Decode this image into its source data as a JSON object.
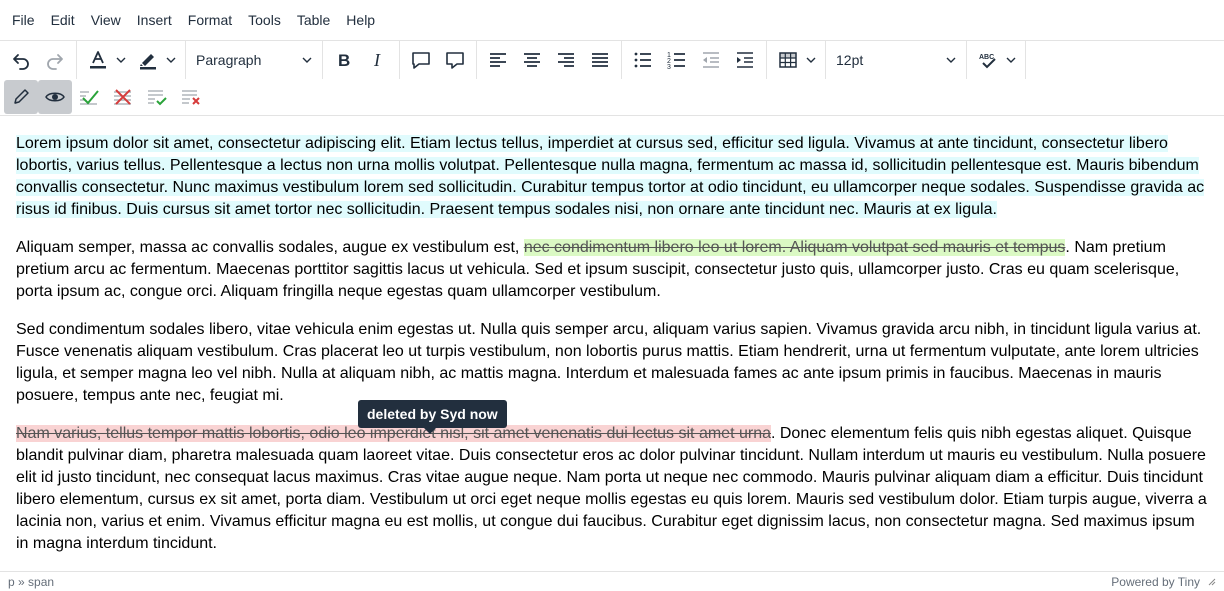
{
  "menubar": {
    "items": [
      {
        "label": "File"
      },
      {
        "label": "Edit"
      },
      {
        "label": "View"
      },
      {
        "label": "Insert"
      },
      {
        "label": "Format"
      },
      {
        "label": "Tools"
      },
      {
        "label": "Table"
      },
      {
        "label": "Help"
      }
    ]
  },
  "toolbar": {
    "block_format": "Paragraph",
    "font_size": "12pt",
    "icons": {
      "undo": "undo-icon",
      "redo": "redo-icon",
      "text_color": "text-color-icon",
      "highlight": "highlight-icon",
      "bold": "bold-icon",
      "italic": "italic-icon",
      "comment_add": "comment-add-icon",
      "comment_show": "comment-show-icon",
      "align_left": "align-left-icon",
      "align_center": "align-center-icon",
      "align_right": "align-right-icon",
      "align_justify": "align-justify-icon",
      "bullet_list": "bullet-list-icon",
      "numbered_list": "numbered-list-icon",
      "outdent": "outdent-icon",
      "indent": "indent-icon",
      "table": "table-icon",
      "spellcheck": "spellcheck-icon"
    },
    "colors": {
      "text_color_bar": "#222f3e",
      "highlight_bar": "#222f3e"
    }
  },
  "revisions_toolbar": {
    "icons": {
      "track_changes": "pencil-icon",
      "show_changes": "eye-icon",
      "accept": "accept-change-icon",
      "reject": "reject-change-icon",
      "accept_all": "accept-all-icon",
      "reject_all": "reject-all-icon"
    },
    "colors": {
      "accept": "#2aa33a",
      "reject": "#d63b3b"
    }
  },
  "document": {
    "p1": "Lorem ipsum dolor sit amet, consectetur adipiscing elit. Etiam lectus tellus, imperdiet at cursus sed, efficitur sed ligula. Vivamus at ante tincidunt, consectetur libero lobortis, varius tellus. Pellentesque a lectus non urna mollis volutpat. Pellentesque nulla magna, fermentum ac massa id, sollicitudin pellentesque est. Mauris bibendum convallis consectetur. Nunc maximus vestibulum lorem sed sollicitudin. Curabitur tempus tortor at odio tincidunt, eu ullamcorper neque sodales. Suspendisse gravida ac risus id finibus. Duis cursus sit amet tortor nec sollicitudin. Praesent tempus sodales nisi, non ornare ante tincidunt nec. Mauris at ex ligula.",
    "p2_before": "Aliquam semper, massa ac convallis sodales, augue ex vestibulum est, ",
    "p2_change": "nec condimentum libero leo ut lorem. Aliquam volutpat sed mauris et tempus",
    "p2_after": ". Nam pretium pretium arcu ac fermentum. Maecenas porttitor sagittis lacus ut vehicula. Sed et ipsum suscipit, consectetur justo quis, ullamcorper justo. Cras eu quam scelerisque, porta ipsum ac, congue orci. Aliquam fringilla neque egestas quam ullamcorper vestibulum.",
    "p3": "Sed condimentum sodales libero, vitae vehicula enim egestas ut. Nulla quis semper arcu, aliquam varius sapien. Vivamus gravida arcu nibh, in tincidunt ligula varius at. Fusce venenatis aliquam vestibulum. Cras placerat leo ut turpis vestibulum, non lobortis purus mattis. Etiam hendrerit, urna ut fermentum vulputate, ante lorem ultricies ligula, et semper magna leo vel nibh. Nulla at aliquam nibh, ac mattis magna. Interdum et malesuada fames ac ante ipsum primis in faucibus. Maecenas in mauris posuere, tempus ante nec, feugiat mi.",
    "p4_deleted": "Nam varius, tellus tempor mattis lobortis, odio leo imperdiet nisl, sit amet venenatis dui lectus sit amet urna",
    "p4_after": ". Donec elementum felis quis nibh egestas aliquet. Quisque blandit pulvinar diam, pharetra malesuada quam laoreet vitae. Duis consectetur eros ac dolor pulvinar tincidunt. Nullam interdum ut mauris eu vestibulum. Nulla posuere elit id justo tincidunt, nec consequat lacus maximus. Cras vitae augue neque. Nam porta ut neque nec commodo. Mauris pulvinar aliquam diam a efficitur. Duis tincidunt libero elementum, cursus ex sit amet, porta diam. Vestibulum ut orci eget neque mollis egestas eu quis lorem. Mauris sed vestibulum dolor. Etiam turpis augue, viverra a lacinia non, varius et enim. Vivamus efficitur magna eu est mollis, ut congue dui faucibus. Curabitur eget dignissim lacus, non consectetur magna. Sed maximus ipsum in magna interdum tincidunt.",
    "colors": {
      "inserted_block": "#e0fbfd",
      "inserted_inline": "#dbf9c4",
      "deleted_inline": "#f9d3d3"
    }
  },
  "tooltip": {
    "text": "deleted by Syd now"
  },
  "statusbar": {
    "path": "p » span",
    "branding": "Powered by Tiny",
    "resize_icon": "resize-handle-icon"
  }
}
